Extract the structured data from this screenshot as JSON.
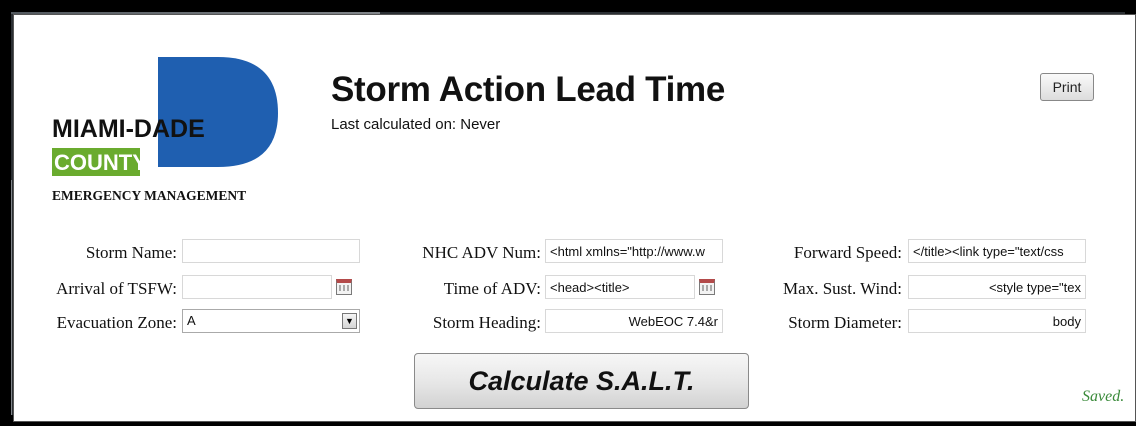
{
  "header": {
    "title": "Storm Action Lead Time",
    "last_calculated": "Last calculated on: Never",
    "print_label": "Print"
  },
  "logo": {
    "line1": "MIAMI-DADE",
    "line2": "COUNTY",
    "line3": "EMERGENCY MANAGEMENT",
    "colors": {
      "blue": "#1f5fb0",
      "green": "#6aab2e"
    }
  },
  "form": {
    "storm_name": {
      "label": "Storm Name:",
      "value": ""
    },
    "arrival_tsfw": {
      "label": "Arrival of TSFW:",
      "value": ""
    },
    "evacuation_zone": {
      "label": "Evacuation Zone:",
      "value": "A"
    },
    "nhc_adv_num": {
      "label": "NHC ADV Num:",
      "value": "<html xmlns=\"http://www.w"
    },
    "time_of_adv": {
      "label": "Time of ADV:",
      "value": "<head><title>"
    },
    "storm_heading": {
      "label": "Storm Heading:",
      "value": "WebEOC 7.4&r"
    },
    "forward_speed": {
      "label": "Forward Speed:",
      "value": "</title><link type=\"text/css"
    },
    "max_sust_wind": {
      "label": "Max. Sust. Wind:",
      "value": "<style type=\"tex"
    },
    "storm_diameter": {
      "label": "Storm Diameter:",
      "value": "body"
    }
  },
  "calculate_label": "Calculate S.A.L.T.",
  "status": "Saved."
}
